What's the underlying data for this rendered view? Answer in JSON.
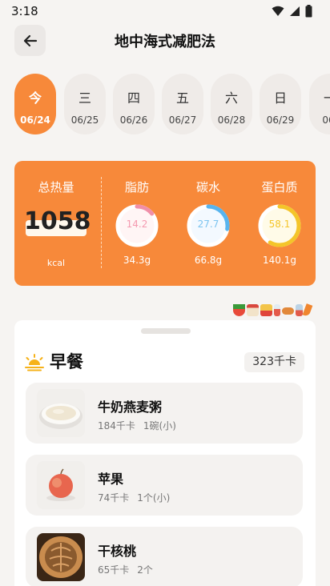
{
  "status": {
    "time": "3:18"
  },
  "header": {
    "title": "地中海式减肥法"
  },
  "days": [
    {
      "week": "今",
      "date": "06/24",
      "active": true
    },
    {
      "week": "三",
      "date": "06/25"
    },
    {
      "week": "四",
      "date": "06/26"
    },
    {
      "week": "五",
      "date": "06/27"
    },
    {
      "week": "六",
      "date": "06/28"
    },
    {
      "week": "日",
      "date": "06/29"
    },
    {
      "week": "一",
      "date": "06/"
    }
  ],
  "summary": {
    "total_label": "总热量",
    "total_value": "1058",
    "unit": "kcal",
    "nutrients": [
      {
        "label": "脂肪",
        "percent": "14.2",
        "fraction": 0.142,
        "grams": "34.3g",
        "color": "#f08fa8",
        "text_color": "#f59ab0"
      },
      {
        "label": "碳水",
        "percent": "27.7",
        "fraction": 0.277,
        "grams": "66.8g",
        "color": "#58b4ee",
        "text_color": "#7cc4f0"
      },
      {
        "label": "蛋白质",
        "percent": "58.1",
        "fraction": 0.581,
        "grams": "140.1g",
        "color": "#f4c52a",
        "text_color": "#f4c52a"
      }
    ]
  },
  "meal": {
    "title": "早餐",
    "kcal": "323千卡",
    "items": [
      {
        "name": "牛奶燕麦粥",
        "kcal": "184千卡",
        "qty": "1碗(小)",
        "icon": "oat-porridge-image"
      },
      {
        "name": "苹果",
        "kcal": "74千卡",
        "qty": "1个(小)",
        "icon": "apple-image"
      },
      {
        "name": "干核桃",
        "kcal": "65千卡",
        "qty": "2个",
        "icon": "walnut-image"
      }
    ]
  },
  "colors": {
    "accent": "#f7893a",
    "background": "#f6f4f2"
  }
}
